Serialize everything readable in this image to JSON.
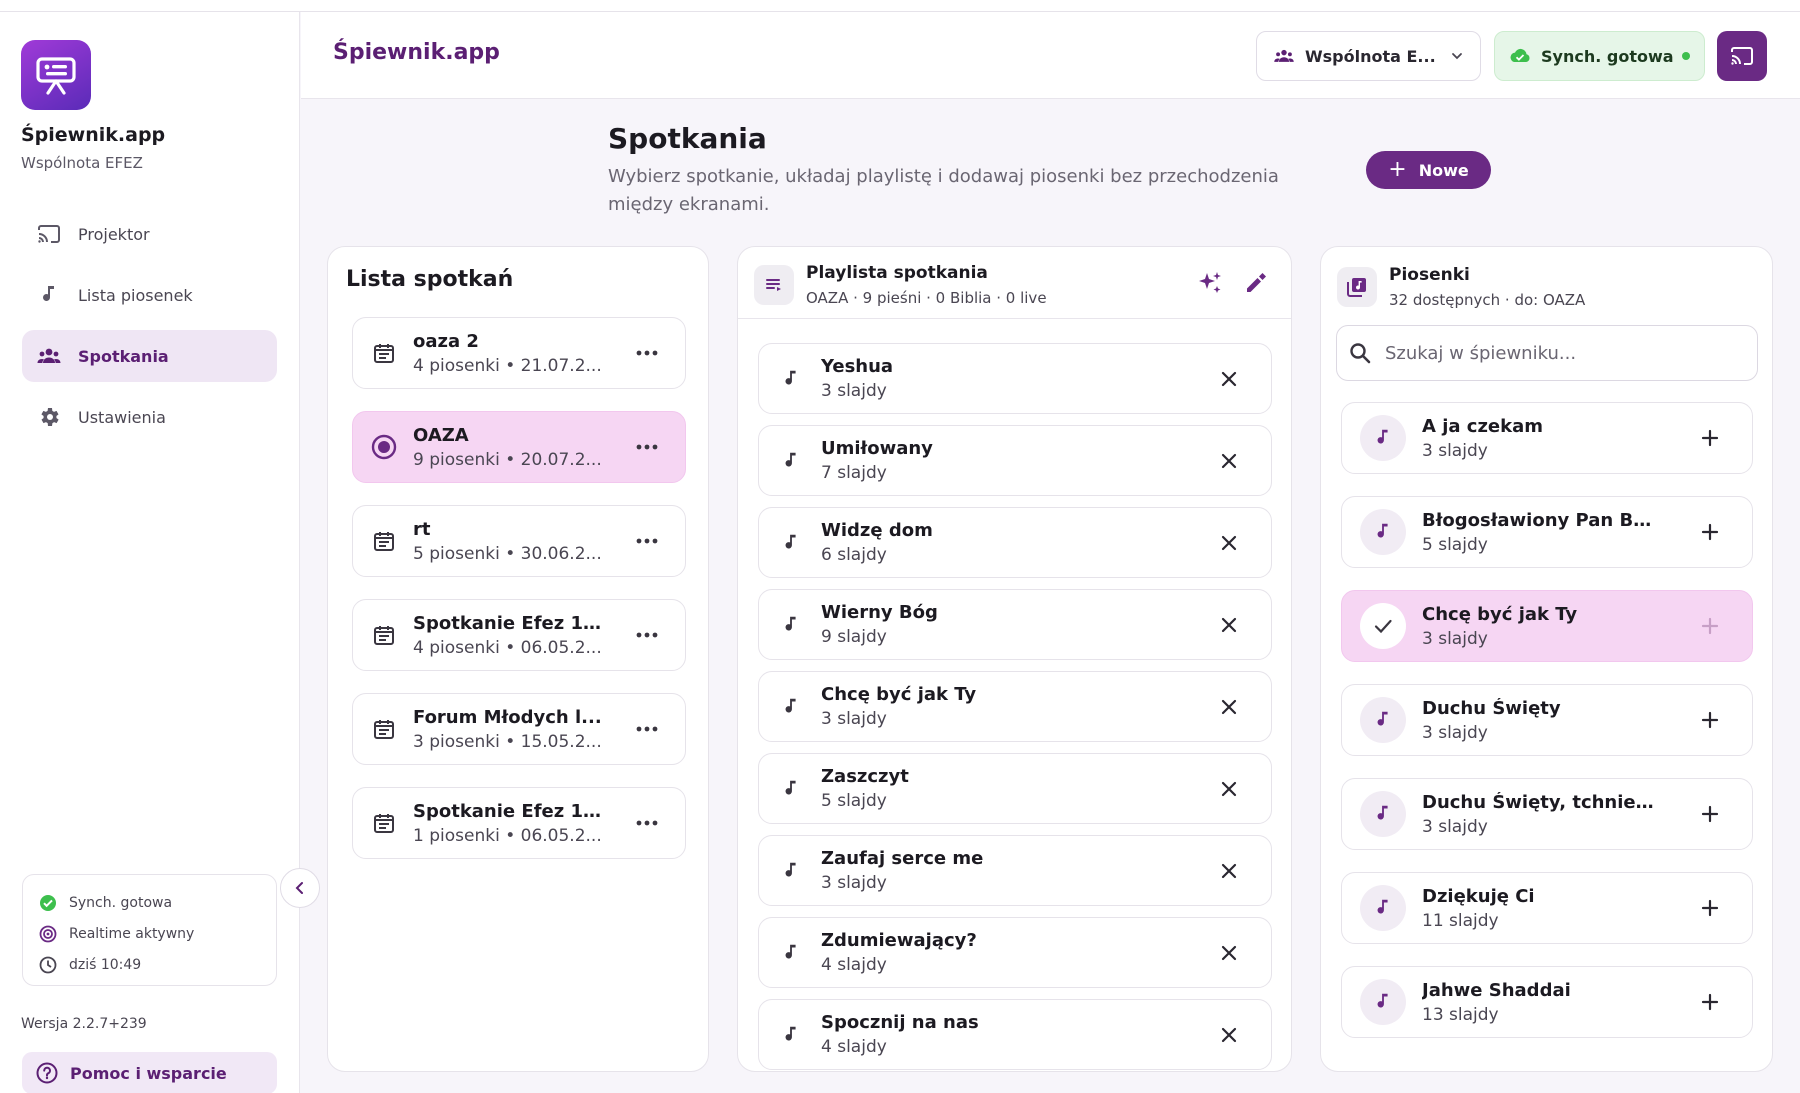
{
  "sidebar": {
    "app_name": "Śpiewnik.app",
    "community": "Wspólnota EFEZ",
    "nav": [
      {
        "label": "Projektor",
        "icon": "cast-icon"
      },
      {
        "label": "Lista piosenek",
        "icon": "music-note-icon"
      },
      {
        "label": "Spotkania",
        "icon": "people-icon",
        "active": true
      },
      {
        "label": "Ustawienia",
        "icon": "gear-icon"
      }
    ],
    "status": {
      "sync": "Synch. gotowa",
      "realtime": "Realtime aktywny",
      "time": "dziś 10:49"
    },
    "version": "Wersja 2.2.7+239",
    "help": "Pomoc i wsparcie"
  },
  "topbar": {
    "brand": "Śpiewnik.app",
    "community_select": "Wspólnota E...",
    "sync_label": "Synch. gotowa"
  },
  "header": {
    "title": "Spotkania",
    "description": "Wybierz spotkanie, układaj playlistę i dodawaj piosenki bez przechodzenia między ekranami.",
    "new_button": "Nowe"
  },
  "meetings": {
    "title": "Lista spotkań",
    "items": [
      {
        "name": "oaza 2",
        "meta": "4 piosenki • 21.07.2...",
        "active": false
      },
      {
        "name": "OAZA",
        "meta": "9 piosenki • 20.07.2...",
        "active": true
      },
      {
        "name": "rt",
        "meta": "5 piosenki • 30.06.2...",
        "active": false
      },
      {
        "name": "Spotkanie Efez 1...",
        "meta": "4 piosenki • 06.05.2...",
        "active": false
      },
      {
        "name": "Forum Młodych l...",
        "meta": "3 piosenki • 15.05.2...",
        "active": false
      },
      {
        "name": "Spotkanie Efez 1...",
        "meta": "1 piosenki • 06.05.2...",
        "active": false
      }
    ]
  },
  "playlist": {
    "title": "Playlista spotkania",
    "meta": "OAZA · 9 pieśni · 0 Biblia · 0 live",
    "items": [
      {
        "name": "Yeshua",
        "meta": "3 slajdy"
      },
      {
        "name": "Umiłowany",
        "meta": "7 slajdy"
      },
      {
        "name": "Widzę dom",
        "meta": "6 slajdy"
      },
      {
        "name": "Wierny Bóg",
        "meta": "9 slajdy"
      },
      {
        "name": "Chcę być jak Ty",
        "meta": "3 slajdy"
      },
      {
        "name": "Zaszczyt",
        "meta": "5 slajdy"
      },
      {
        "name": "Zaufaj serce me",
        "meta": "3 slajdy"
      },
      {
        "name": "Zdumiewający?",
        "meta": "4 slajdy"
      },
      {
        "name": "Spocznij na nas",
        "meta": "4 slajdy"
      }
    ]
  },
  "songs": {
    "title": "Piosenki",
    "meta": "32 dostępnych · do: OAZA",
    "search_placeholder": "Szukaj w śpiewniku...",
    "items": [
      {
        "name": "A ja czekam",
        "meta": "3 slajdy",
        "added": false
      },
      {
        "name": "Błogosławiony Pan Bó...",
        "meta": "5 slajdy",
        "added": false
      },
      {
        "name": "Chcę być jak Ty",
        "meta": "3 slajdy",
        "added": true
      },
      {
        "name": "Duchu Święty",
        "meta": "3 slajdy",
        "added": false
      },
      {
        "name": "Duchu Święty, tchnieni...",
        "meta": "3 slajdy",
        "added": false
      },
      {
        "name": "Dziękuję Ci",
        "meta": "11 slajdy",
        "added": false
      },
      {
        "name": "Jahwe Shaddai",
        "meta": "13 slajdy",
        "added": false
      }
    ]
  },
  "colors": {
    "accent": "#6a2a84",
    "accent_light": "#f6d6f3",
    "sync_green": "#3dbf4d"
  }
}
